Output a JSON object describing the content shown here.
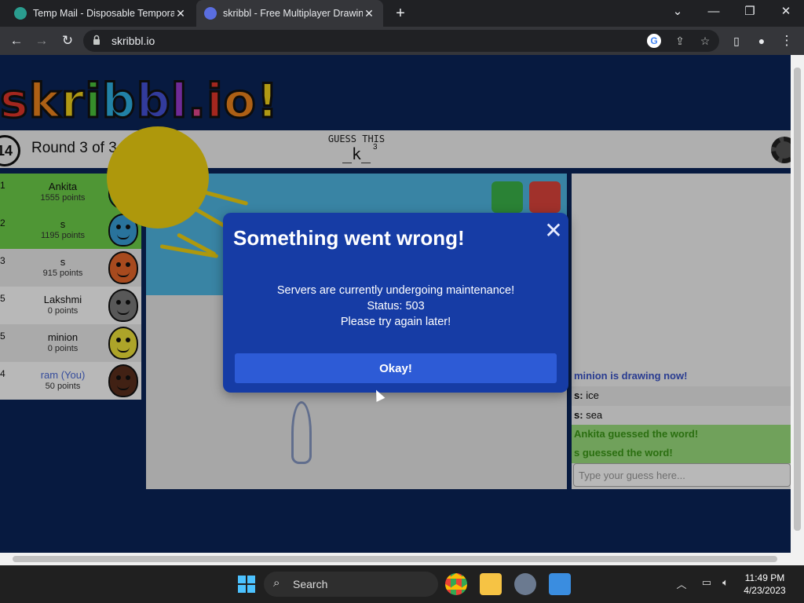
{
  "browser": {
    "tabs": [
      {
        "title": "Temp Mail - Disposable Temporary Email",
        "favicon_color": "#2a9d8f"
      },
      {
        "title": "skribbl - Free Multiplayer Drawing & Guessing Game",
        "favicon_color": "#5a6ee0"
      }
    ],
    "url": "skribbl.io"
  },
  "game": {
    "logo_text": "skribbl.io!",
    "timer": "14",
    "round_label": "Round 3 of 3",
    "guess_this": "GUESS THIS",
    "word_hint": "_k_",
    "word_length": "3",
    "players": [
      {
        "rank": "1",
        "name": "Ankita",
        "points": "1555 points",
        "bg": "#6ed04a",
        "avatar_color": "#1ecb7d"
      },
      {
        "rank": "2",
        "name": "s",
        "points": "1195 points",
        "bg": "#6ed04a",
        "avatar_color": "#39a0d8"
      },
      {
        "rank": "3",
        "name": "s",
        "points": "915 points",
        "bg": "#ececec",
        "avatar_color": "#e8672a"
      },
      {
        "rank": "5",
        "name": "Lakshmi",
        "points": "0 points",
        "bg": "#ffffff",
        "avatar_color": "#7a7a7a"
      },
      {
        "rank": "5",
        "name": "minion",
        "points": "0 points",
        "bg": "#ececec",
        "avatar_color": "#f0e33a"
      },
      {
        "rank": "4",
        "name": "ram (You)",
        "points": "50 points",
        "bg": "#ffffff",
        "avatar_color": "#5a2e1c",
        "name_color": "#4a6ad8"
      }
    ]
  },
  "chat": {
    "messages": [
      {
        "text": "minion is drawing now!",
        "style": "blue"
      },
      {
        "author": "s:",
        "text": "ice",
        "style": "gray"
      },
      {
        "author": "s:",
        "text": "sea",
        "style": "white"
      },
      {
        "text": "Ankita guessed the word!",
        "style": "green"
      },
      {
        "text": "s guessed the word!",
        "style": "green"
      }
    ],
    "input_placeholder": "Type your guess here..."
  },
  "dialog": {
    "title": "Something went wrong!",
    "line1": "Servers are currently undergoing maintenance!",
    "line2": "Status: 503",
    "line3": "Please try again later!",
    "button": "Okay!"
  },
  "taskbar": {
    "search_label": "Search",
    "time": "11:49 PM",
    "date": "4/23/2023"
  }
}
